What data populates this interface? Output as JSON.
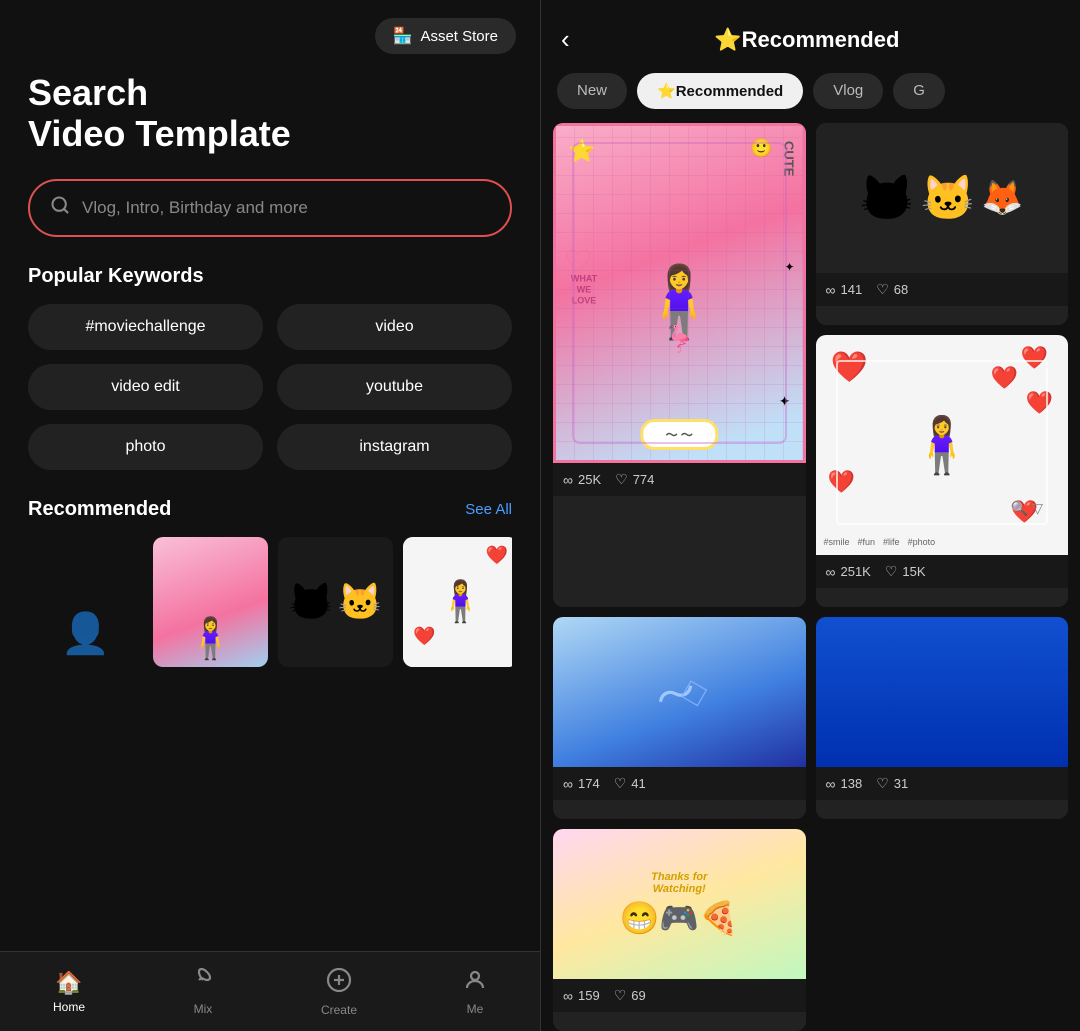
{
  "left": {
    "asset_store_label": "Asset Store",
    "title_line1": "Search",
    "title_line2": "Video Template",
    "search_placeholder": "Vlog, Intro, Birthday and more",
    "popular_keywords_title": "Popular Keywords",
    "keywords": [
      "#moviechallenge",
      "video",
      "video edit",
      "youtube",
      "photo",
      "instagram"
    ],
    "recommended_title": "Recommended",
    "see_all_label": "See All"
  },
  "right": {
    "header_title": "⭐Recommended",
    "tabs": [
      {
        "label": "New",
        "active": false
      },
      {
        "label": "⭐Recommended",
        "active": true
      },
      {
        "label": "Vlog",
        "active": false
      },
      {
        "label": "G",
        "active": false
      }
    ],
    "items": [
      {
        "type": "cute-pink",
        "views": "25K",
        "likes": "774",
        "tall": true
      },
      {
        "type": "silhouette",
        "views": "141",
        "likes": "68"
      },
      {
        "type": "hearts",
        "views": "251K",
        "likes": "15K"
      },
      {
        "type": "blue-abstract",
        "views": "174",
        "likes": "41"
      },
      {
        "type": "blue-solid",
        "views": "138",
        "likes": "31"
      },
      {
        "type": "thanks",
        "views": "159",
        "likes": "69"
      }
    ]
  },
  "nav": {
    "items": [
      {
        "icon": "🏠",
        "label": "Home",
        "active": true
      },
      {
        "icon": "∞",
        "label": "Mix",
        "active": false
      },
      {
        "icon": "⊕",
        "label": "Create",
        "active": false
      },
      {
        "icon": "👤",
        "label": "Me",
        "active": false
      }
    ]
  }
}
